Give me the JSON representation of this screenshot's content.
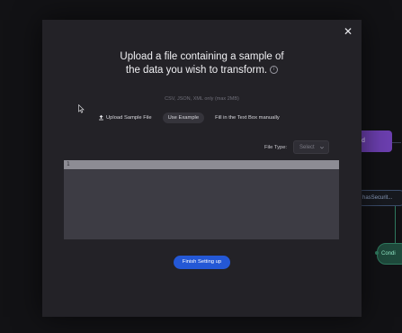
{
  "background": {
    "node_purple_label": "d",
    "node_pill_label": "hasSecurit...",
    "node_green_label": "Condi"
  },
  "modal": {
    "close_label": "✕",
    "title_line1": "Upload a file containing a sample of",
    "title_line2": "the data you wish to transform.",
    "info_icon": "i",
    "hint": "CSV, JSON, XML only (max 2MB)",
    "upload_label": "Upload Sample File",
    "example_label": "Use Example",
    "manual_label": "Fill in the Text Box manually",
    "file_type_label": "File Type:",
    "file_type_value": "Select",
    "editor_line_number": "1",
    "finish_label": "Finish Setting up"
  },
  "colors": {
    "accent": "#2458d6",
    "modal_bg": "#232227",
    "editor_bg": "#3d3c44"
  },
  "icons": [
    "close-icon",
    "info-icon",
    "upload-icon",
    "chevron-down-icon",
    "mouse-pointer-icon"
  ]
}
